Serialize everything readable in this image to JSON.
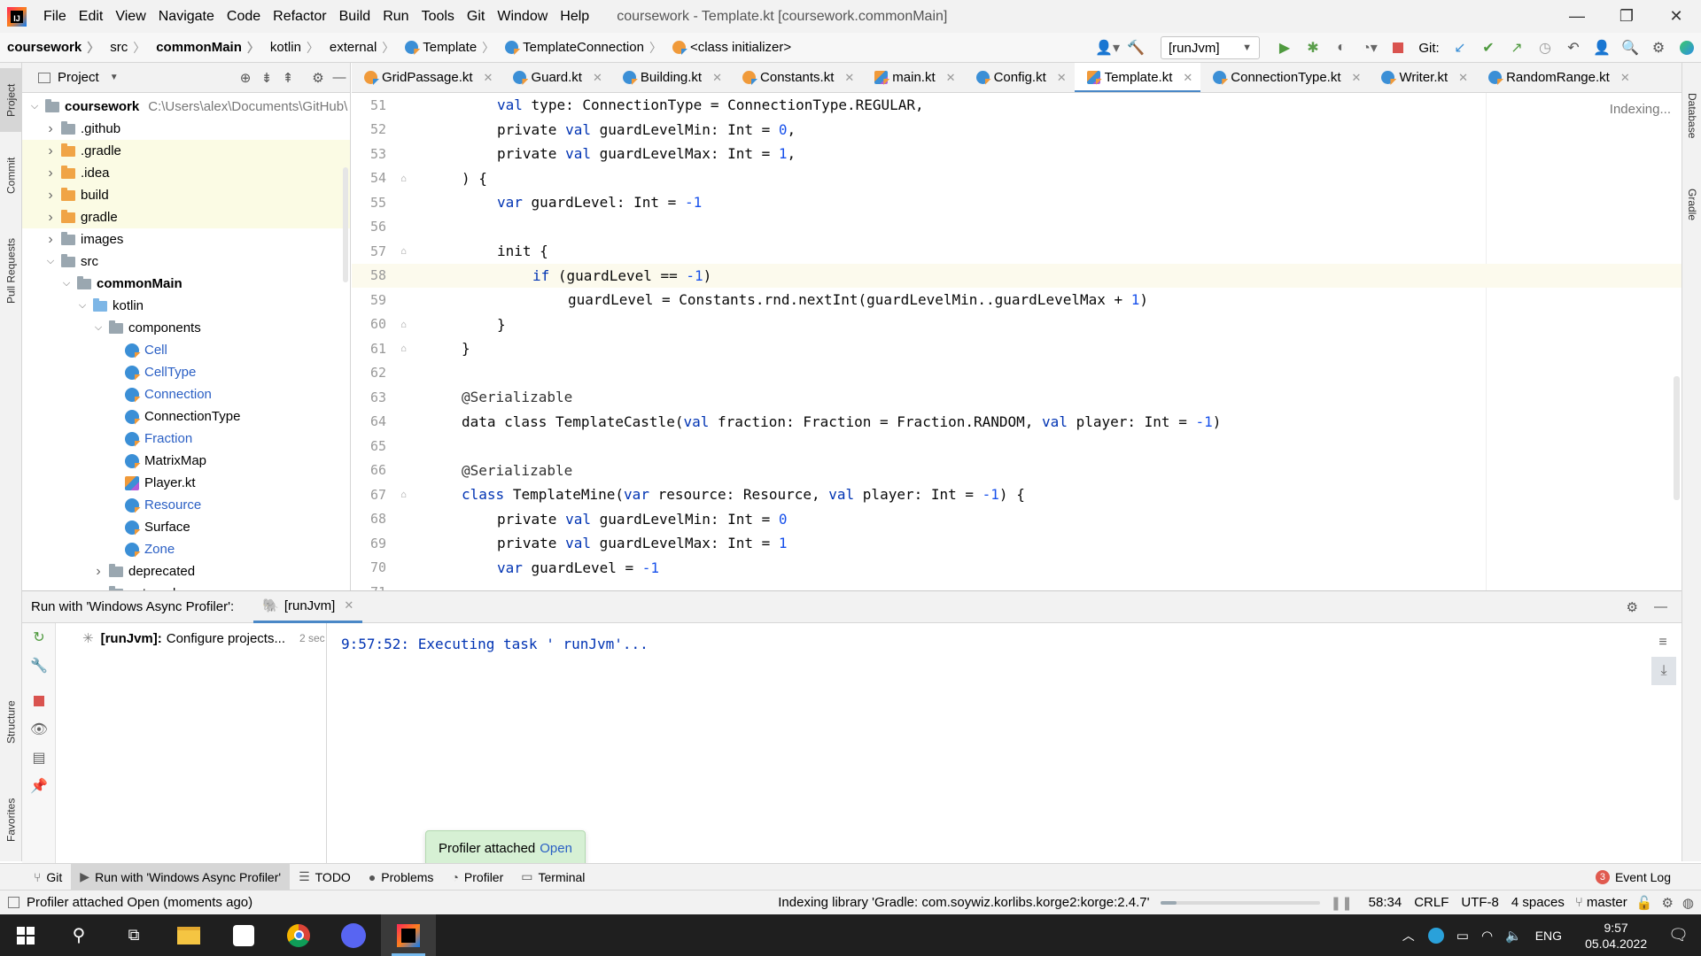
{
  "menu": {
    "logo": "IJ",
    "items": [
      "File",
      "Edit",
      "View",
      "Navigate",
      "Code",
      "Refactor",
      "Build",
      "Run",
      "Tools",
      "Git",
      "Window",
      "Help"
    ],
    "window_title": "coursework - Template.kt [coursework.commonMain]"
  },
  "window_controls": {
    "minimize": "—",
    "maximize": "❐",
    "close": "✕"
  },
  "breadcrumb": [
    "coursework",
    "src",
    "commonMain",
    "kotlin",
    "external",
    "Template",
    "TemplateConnection",
    "<class initializer>"
  ],
  "toolbar": {
    "run_config": "[runJvm]",
    "git_label": "Git:"
  },
  "left_tool_tabs": [
    "Project",
    "Commit",
    "Pull Requests",
    "Structure",
    "Favorites"
  ],
  "right_tool_tabs": [
    "Database",
    "Gradle"
  ],
  "project_panel": {
    "title": "Project",
    "root_path": "C:\\Users\\alex\\Documents\\GitHub\\",
    "tree": [
      {
        "label": "coursework",
        "level": 0,
        "expanded": true,
        "type": "module",
        "bold": true
      },
      {
        "label": ".github",
        "level": 1,
        "expanded": false,
        "type": "folder"
      },
      {
        "label": ".gradle",
        "level": 1,
        "expanded": false,
        "type": "folder-orange",
        "highlight": true
      },
      {
        "label": ".idea",
        "level": 1,
        "expanded": false,
        "type": "folder-orange",
        "highlight": true
      },
      {
        "label": "build",
        "level": 1,
        "expanded": false,
        "type": "folder-orange",
        "highlight": true
      },
      {
        "label": "gradle",
        "level": 1,
        "expanded": false,
        "type": "folder-orange",
        "highlight": true
      },
      {
        "label": "images",
        "level": 1,
        "expanded": false,
        "type": "folder"
      },
      {
        "label": "src",
        "level": 1,
        "expanded": true,
        "type": "folder"
      },
      {
        "label": "commonMain",
        "level": 2,
        "expanded": true,
        "type": "folder",
        "bold": true
      },
      {
        "label": "kotlin",
        "level": 3,
        "expanded": true,
        "type": "folder-blue"
      },
      {
        "label": "components",
        "level": 4,
        "expanded": true,
        "type": "folder"
      },
      {
        "label": "Cell",
        "level": 5,
        "type": "kt-class",
        "blue": true
      },
      {
        "label": "CellType",
        "level": 5,
        "type": "kt-class",
        "blue": true
      },
      {
        "label": "Connection",
        "level": 5,
        "type": "kt-class",
        "blue": true
      },
      {
        "label": "ConnectionType",
        "level": 5,
        "type": "kt-class"
      },
      {
        "label": "Fraction",
        "level": 5,
        "type": "kt-class",
        "blue": true
      },
      {
        "label": "MatrixMap",
        "level": 5,
        "type": "kt-class"
      },
      {
        "label": "Player.kt",
        "level": 5,
        "type": "kt-file"
      },
      {
        "label": "Resource",
        "level": 5,
        "type": "kt-class",
        "blue": true
      },
      {
        "label": "Surface",
        "level": 5,
        "type": "kt-class"
      },
      {
        "label": "Zone",
        "level": 5,
        "type": "kt-class",
        "blue": true
      },
      {
        "label": "deprecated",
        "level": 4,
        "expanded": false,
        "type": "folder"
      },
      {
        "label": "external",
        "level": 4,
        "expanded": true,
        "type": "folder"
      }
    ]
  },
  "editor_tabs": [
    {
      "label": "GridPassage.kt",
      "icon": "kt-orange"
    },
    {
      "label": "Guard.kt",
      "icon": "kt"
    },
    {
      "label": "Building.kt",
      "icon": "kt"
    },
    {
      "label": "Constants.kt",
      "icon": "kt-orange"
    },
    {
      "label": "main.kt",
      "icon": "file"
    },
    {
      "label": "Config.kt",
      "icon": "kt"
    },
    {
      "label": "Template.kt",
      "icon": "file",
      "active": true
    },
    {
      "label": "ConnectionType.kt",
      "icon": "kt"
    },
    {
      "label": "Writer.kt",
      "icon": "kt"
    },
    {
      "label": "RandomRange.kt",
      "icon": "kt"
    }
  ],
  "editor": {
    "indexing_label": "Indexing...",
    "current_line": 58,
    "lines": [
      {
        "n": "51",
        "indent": 2,
        "tokens": [
          [
            "kw",
            "val"
          ],
          [
            "",
            "type: ConnectionType = ConnectionType.REGULAR,"
          ]
        ]
      },
      {
        "n": "52",
        "indent": 2,
        "tokens": [
          [
            "",
            "private "
          ],
          [
            "kw",
            "val"
          ],
          [
            "",
            "guardLevelMin: Int = "
          ],
          [
            "num",
            "0"
          ],
          [
            "",
            ","
          ]
        ]
      },
      {
        "n": "53",
        "indent": 2,
        "tokens": [
          [
            "",
            "private "
          ],
          [
            "kw",
            "val"
          ],
          [
            "",
            "guardLevelMax: Int = "
          ],
          [
            "num",
            "1"
          ],
          [
            "",
            ","
          ]
        ]
      },
      {
        "n": "54",
        "indent": 1,
        "fold": true,
        "tokens": [
          [
            "",
            ") {"
          ]
        ]
      },
      {
        "n": "55",
        "indent": 2,
        "tokens": [
          [
            "kw",
            "var"
          ],
          [
            "",
            "guardLevel: Int = "
          ],
          [
            "num",
            "-1"
          ]
        ]
      },
      {
        "n": "56",
        "indent": 0,
        "tokens": []
      },
      {
        "n": "57",
        "indent": 2,
        "fold": true,
        "tokens": [
          [
            "",
            "init {"
          ]
        ]
      },
      {
        "n": "58",
        "indent": 3,
        "tokens": [
          [
            "kw",
            "if"
          ],
          [
            "",
            "(guardLevel == "
          ],
          [
            "num",
            "-1"
          ],
          [
            "",
            ")"
          ]
        ]
      },
      {
        "n": "59",
        "indent": 4,
        "tokens": [
          [
            "",
            "guardLevel = Constants.rnd.nextInt(guardLevelMin..guardLevelMax + "
          ],
          [
            "num",
            "1"
          ],
          [
            "",
            ")"
          ]
        ]
      },
      {
        "n": "60",
        "indent": 2,
        "fold": true,
        "tokens": [
          [
            "",
            "}"
          ]
        ]
      },
      {
        "n": "61",
        "indent": 1,
        "fold": true,
        "tokens": [
          [
            "",
            "}"
          ]
        ]
      },
      {
        "n": "62",
        "indent": 0,
        "tokens": []
      },
      {
        "n": "63",
        "indent": 1,
        "tokens": [
          [
            "ann",
            "@Serializable"
          ]
        ]
      },
      {
        "n": "64",
        "indent": 1,
        "tokens": [
          [
            "",
            "data class TemplateCastle("
          ],
          [
            "kw",
            "val"
          ],
          [
            "",
            "fraction: Fraction = Fraction.RANDOM, "
          ],
          [
            "kw",
            "val"
          ],
          [
            "",
            "player: Int = "
          ],
          [
            "num",
            "-1"
          ],
          [
            "",
            ")"
          ]
        ]
      },
      {
        "n": "65",
        "indent": 0,
        "tokens": []
      },
      {
        "n": "66",
        "indent": 1,
        "tokens": [
          [
            "ann",
            "@Serializable"
          ]
        ]
      },
      {
        "n": "67",
        "indent": 1,
        "fold": true,
        "tokens": [
          [
            "kw",
            "class"
          ],
          [
            "",
            "TemplateMine("
          ],
          [
            "kw",
            "var"
          ],
          [
            "",
            "resource: Resource, "
          ],
          [
            "kw",
            "val"
          ],
          [
            "",
            "player: Int = "
          ],
          [
            "num",
            "-1"
          ],
          [
            "",
            ") {"
          ]
        ]
      },
      {
        "n": "68",
        "indent": 2,
        "tokens": [
          [
            "",
            "private "
          ],
          [
            "kw",
            "val"
          ],
          [
            "",
            "guardLevelMin: Int = "
          ],
          [
            "num",
            "0"
          ]
        ]
      },
      {
        "n": "69",
        "indent": 2,
        "tokens": [
          [
            "",
            "private "
          ],
          [
            "kw",
            "val"
          ],
          [
            "",
            "guardLevelMax: Int = "
          ],
          [
            "num",
            "1"
          ]
        ]
      },
      {
        "n": "70",
        "indent": 2,
        "tokens": [
          [
            "kw",
            "var"
          ],
          [
            "",
            "guardLevel = "
          ],
          [
            "num",
            "-1"
          ]
        ]
      },
      {
        "n": "71",
        "indent": 0,
        "tokens": []
      }
    ]
  },
  "run_panel": {
    "title": "Run with 'Windows Async Profiler':",
    "tab_label": "[runJvm]",
    "build_task": "[runJvm]:",
    "build_status": "Configure projects...",
    "build_time": "2 sec",
    "console_output": "9:57:52: Executing task ' runJvm'..."
  },
  "profiler_toast": {
    "text": "Profiler attached",
    "link": "Open"
  },
  "tool_windows": [
    {
      "label": "Git",
      "icon": "⑂"
    },
    {
      "label": "Run with 'Windows Async Profiler'",
      "icon": "▶",
      "active": true
    },
    {
      "label": "TODO",
      "icon": "☰"
    },
    {
      "label": "Problems",
      "icon": "●"
    },
    {
      "label": "Profiler",
      "icon": "◔"
    },
    {
      "label": "Terminal",
      "icon": "▭"
    }
  ],
  "event_log": {
    "count": "3",
    "label": "Event Log"
  },
  "status_bar": {
    "message": "Profiler attached Open (moments ago)",
    "indexing": "Indexing library 'Gradle: com.soywiz.korlibs.korge2:korge:2.4.7'",
    "progress_fraction": 0.1,
    "position": "58:34",
    "line_sep": "CRLF",
    "encoding": "UTF-8",
    "indent": "4 spaces",
    "branch": "master"
  },
  "taskbar": {
    "language": "ENG",
    "time": "9:57",
    "date": "05.04.2022"
  }
}
